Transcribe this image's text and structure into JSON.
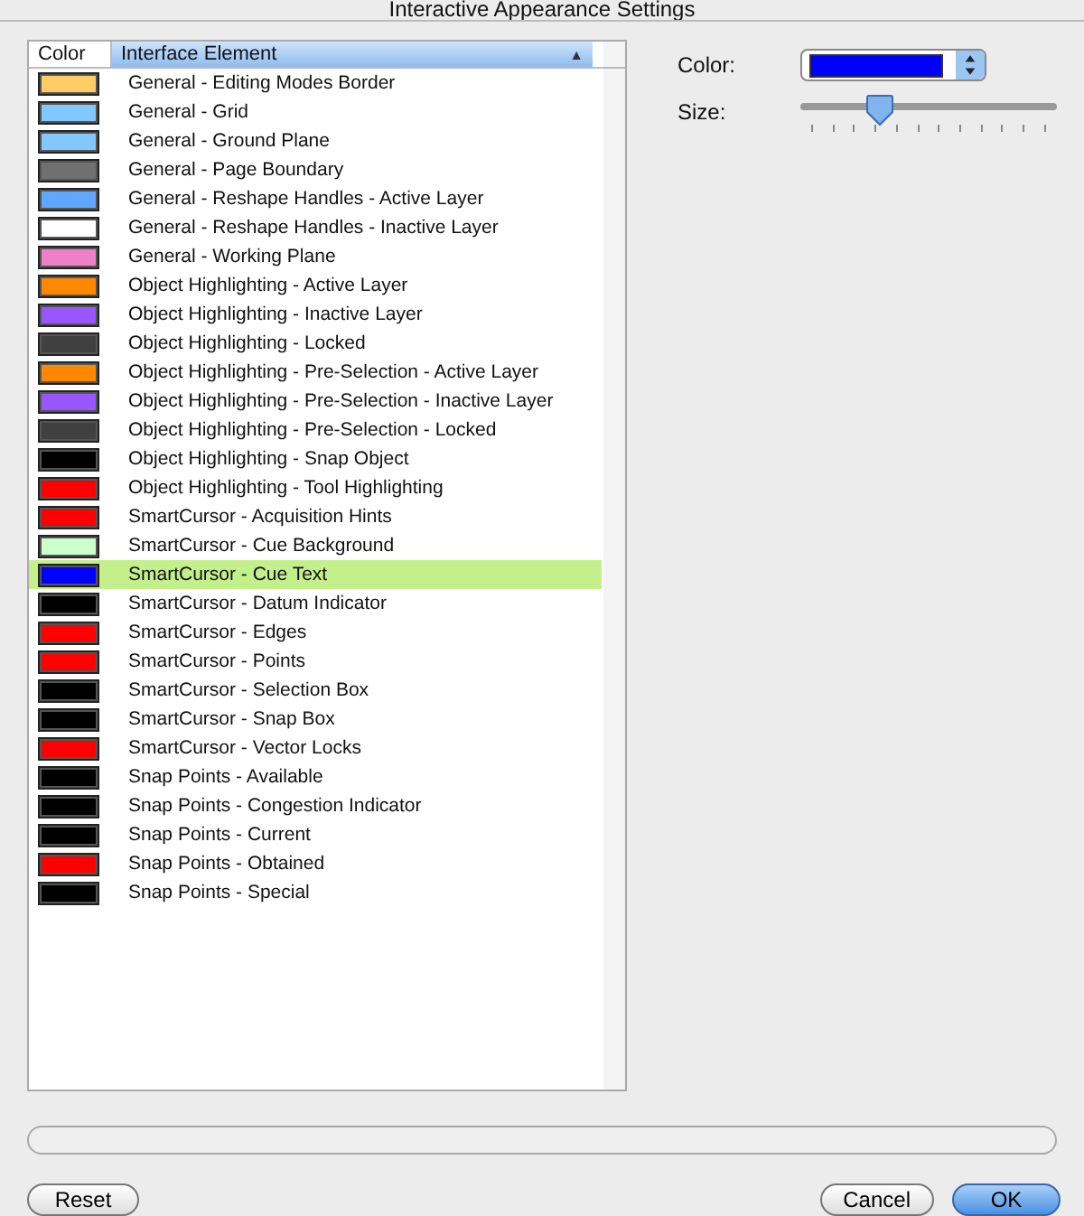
{
  "window": {
    "title": "Interactive Appearance Settings"
  },
  "table": {
    "columns": [
      {
        "label": "Color",
        "sorted": false
      },
      {
        "label": "Interface Element",
        "sorted": true,
        "sort_indicator": "▲"
      }
    ],
    "rows": [
      {
        "color": "#ffcc66",
        "name": "General - Editing Modes Border",
        "selected": false
      },
      {
        "color": "#80c8ff",
        "name": "General - Grid",
        "selected": false
      },
      {
        "color": "#80c8ff",
        "name": "General - Ground Plane",
        "selected": false
      },
      {
        "color": "#707070",
        "name": "General - Page Boundary",
        "selected": false
      },
      {
        "color": "#60a8ff",
        "name": "General - Reshape Handles - Active Layer",
        "selected": false
      },
      {
        "color": "#ffffff",
        "name": "General - Reshape Handles - Inactive Layer",
        "selected": false
      },
      {
        "color": "#ee80c8",
        "name": "General - Working Plane",
        "selected": false
      },
      {
        "color": "#ff8800",
        "name": "Object Highlighting - Active Layer",
        "selected": false
      },
      {
        "color": "#9955ff",
        "name": "Object Highlighting - Inactive Layer",
        "selected": false
      },
      {
        "color": "#404040",
        "name": "Object Highlighting - Locked",
        "selected": false
      },
      {
        "color": "#ff8800",
        "name": "Object Highlighting - Pre-Selection - Active Layer",
        "selected": false
      },
      {
        "color": "#9955ff",
        "name": "Object Highlighting - Pre-Selection - Inactive Layer",
        "selected": false
      },
      {
        "color": "#404040",
        "name": "Object Highlighting - Pre-Selection - Locked",
        "selected": false
      },
      {
        "color": "#000000",
        "name": "Object Highlighting - Snap Object",
        "selected": false
      },
      {
        "color": "#ff0000",
        "name": "Object Highlighting - Tool Highlighting",
        "selected": false
      },
      {
        "color": "#ff0000",
        "name": "SmartCursor - Acquisition Hints",
        "selected": false
      },
      {
        "color": "#ccffcc",
        "name": "SmartCursor - Cue Background",
        "selected": false
      },
      {
        "color": "#0000ff",
        "name": "SmartCursor - Cue Text",
        "selected": true
      },
      {
        "color": "#000000",
        "name": "SmartCursor - Datum Indicator",
        "selected": false
      },
      {
        "color": "#ff0000",
        "name": "SmartCursor - Edges",
        "selected": false
      },
      {
        "color": "#ff0000",
        "name": "SmartCursor - Points",
        "selected": false
      },
      {
        "color": "#000000",
        "name": "SmartCursor - Selection Box",
        "selected": false
      },
      {
        "color": "#000000",
        "name": "SmartCursor - Snap Box",
        "selected": false
      },
      {
        "color": "#ff0000",
        "name": "SmartCursor - Vector Locks",
        "selected": false
      },
      {
        "color": "#000000",
        "name": "Snap Points - Available",
        "selected": false
      },
      {
        "color": "#000000",
        "name": "Snap Points - Congestion Indicator",
        "selected": false
      },
      {
        "color": "#000000",
        "name": "Snap Points - Current",
        "selected": false
      },
      {
        "color": "#ff0000",
        "name": "Snap Points - Obtained",
        "selected": false
      },
      {
        "color": "#000000",
        "name": "Snap Points - Special",
        "selected": false
      }
    ]
  },
  "settings": {
    "color_label": "Color:",
    "color": "#0000ff",
    "size_label": "Size:",
    "size": {
      "level": 0.31
    }
  },
  "progress": {
    "level": 0
  },
  "buttons": [
    {
      "label": "Reset",
      "default": false
    },
    {
      "label": "Cancel",
      "default": false
    },
    {
      "label": "OK",
      "default": true
    }
  ]
}
